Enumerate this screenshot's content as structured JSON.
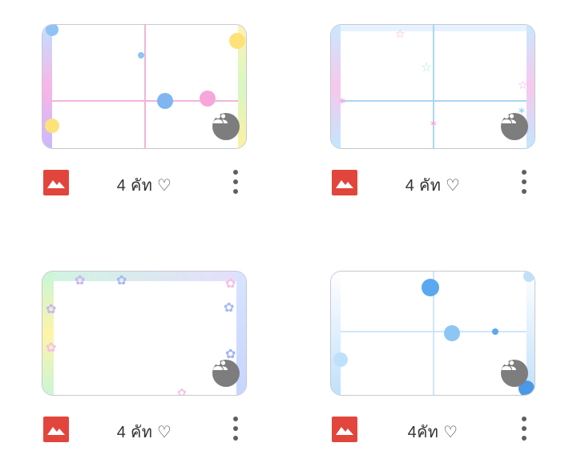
{
  "albums": [
    {
      "title": "4 คัท ♡",
      "theme": "pastel-flowers",
      "accent_colors": [
        "#f6a6d8",
        "#8fc3f5",
        "#fde27a"
      ]
    },
    {
      "title": "4 คัท ♡",
      "theme": "pastel-butterflies",
      "accent_colors": [
        "#9ed6f5",
        "#f5a8e0",
        "#a8f0c9"
      ]
    },
    {
      "title": "4 คัท ♡",
      "theme": "pastel-flower-border",
      "accent_colors": [
        "#c7b6f5",
        "#a6f0d0",
        "#fff4a8"
      ]
    },
    {
      "title": "4คัท ♡",
      "theme": "blue-flowers",
      "accent_colors": [
        "#6bb6f5",
        "#dff0ff",
        "#ffffff"
      ]
    }
  ],
  "icons": {
    "shared": "shared-people-icon",
    "album": "photo-album-icon",
    "more": "more-vert-icon"
  },
  "colors": {
    "album_icon_bg": "#e2453c",
    "shared_badge_bg": "#7d7d7d",
    "text": "#333333"
  }
}
